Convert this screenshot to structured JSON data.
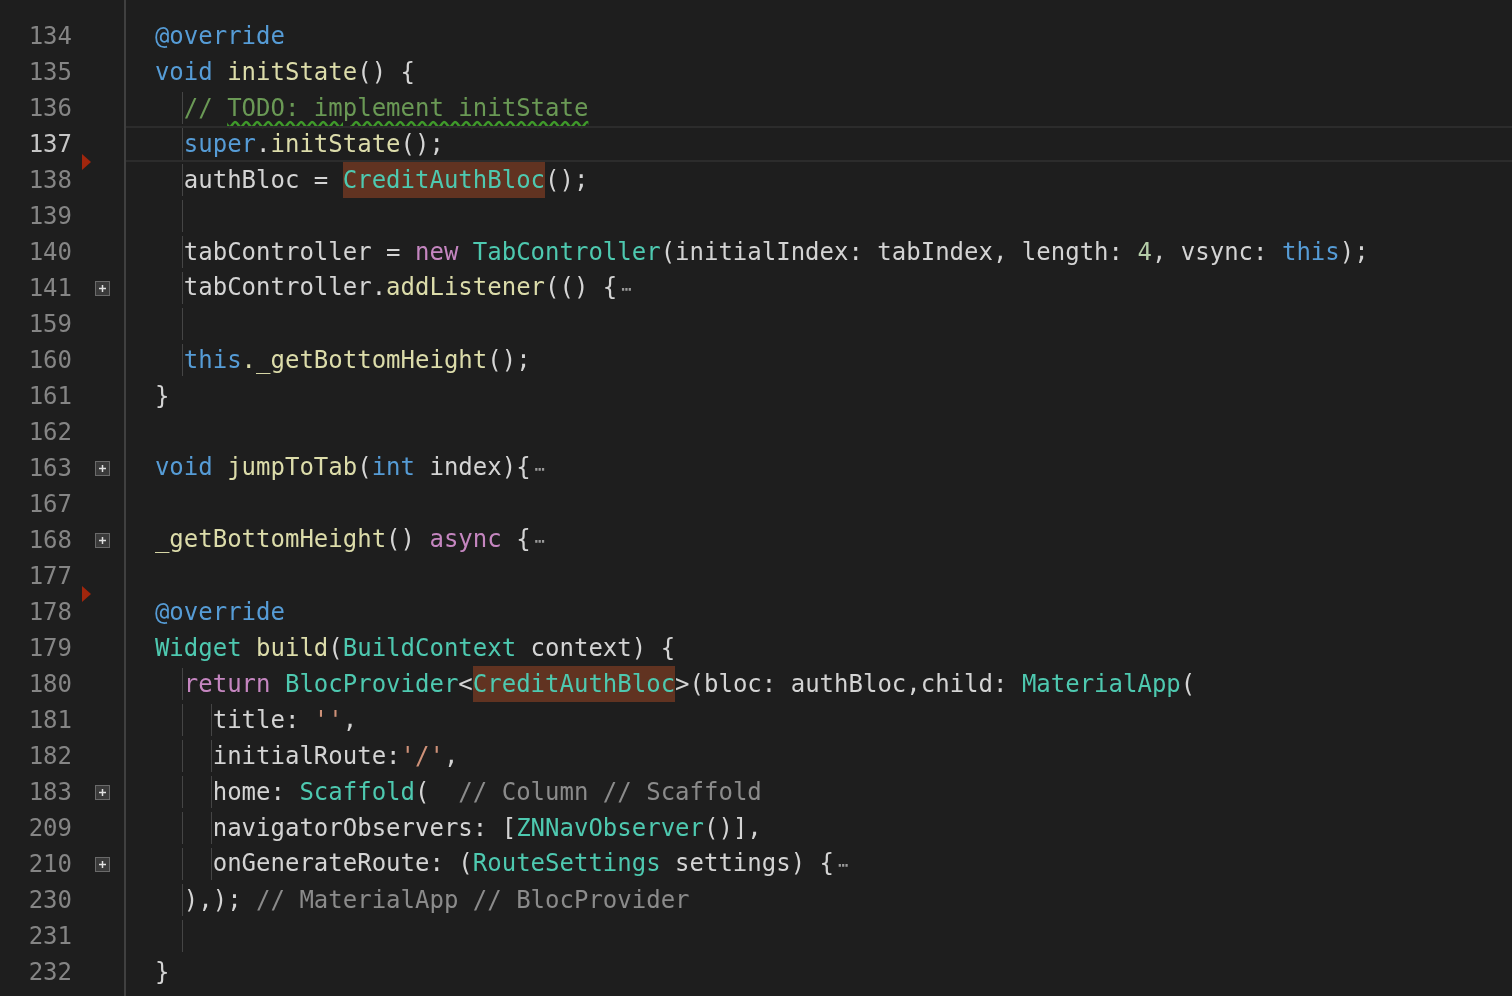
{
  "editor": {
    "lines": [
      {
        "number": "134",
        "current": false,
        "fold": false,
        "marker": false,
        "tokens": [
          {
            "kind": "keyword",
            "text": "  @override"
          }
        ]
      },
      {
        "number": "135",
        "current": false,
        "fold": false,
        "marker": false,
        "tokens": [
          {
            "kind": "keyword",
            "text": "  void "
          },
          {
            "kind": "function",
            "text": "initState"
          },
          {
            "kind": "plain",
            "text": "() {"
          }
        ]
      },
      {
        "number": "136",
        "current": false,
        "fold": false,
        "marker": false,
        "tokens": [
          {
            "kind": "comment",
            "text": "    // "
          },
          {
            "kind": "todo",
            "text": "TODO: implement initState"
          }
        ]
      },
      {
        "number": "137",
        "current": true,
        "fold": false,
        "marker": false,
        "tokens": [
          {
            "kind": "keyword",
            "text": "    super"
          },
          {
            "kind": "plain",
            "text": "."
          },
          {
            "kind": "function",
            "text": "initState"
          },
          {
            "kind": "plain",
            "text": "();"
          }
        ]
      },
      {
        "number": "138",
        "current": false,
        "fold": false,
        "marker": true,
        "tokens": [
          {
            "kind": "plain",
            "text": "    authBloc = "
          },
          {
            "kind": "match",
            "text": "CreditAuthBloc"
          },
          {
            "kind": "plain",
            "text": "();"
          }
        ]
      },
      {
        "number": "139",
        "current": false,
        "fold": false,
        "marker": false
      },
      {
        "number": "140",
        "current": false,
        "fold": false,
        "marker": false,
        "tokens": [
          {
            "kind": "plain",
            "text": "    tabController = "
          },
          {
            "kind": "control",
            "text": "new "
          },
          {
            "kind": "type",
            "text": "TabController"
          },
          {
            "kind": "plain",
            "text": "(initialIndex: tabIndex, length: "
          },
          {
            "kind": "number",
            "text": "4"
          },
          {
            "kind": "plain",
            "text": ", vsync: "
          },
          {
            "kind": "keyword",
            "text": "this"
          },
          {
            "kind": "plain",
            "text": ");"
          }
        ]
      },
      {
        "number": "141",
        "current": false,
        "fold": true,
        "marker": false,
        "tokens": [
          {
            "kind": "plain",
            "text": "    tabController."
          },
          {
            "kind": "function",
            "text": "addListener"
          },
          {
            "kind": "plain",
            "text": "(() {"
          },
          {
            "kind": "ellipsis",
            "text": "⋯"
          }
        ]
      },
      {
        "number": "159",
        "current": false,
        "fold": false,
        "marker": false
      },
      {
        "number": "160",
        "current": false,
        "fold": false,
        "marker": false,
        "tokens": [
          {
            "kind": "keyword",
            "text": "    this"
          },
          {
            "kind": "function",
            "text": "._getBottomHeight"
          },
          {
            "kind": "plain",
            "text": "();"
          }
        ]
      },
      {
        "number": "161",
        "current": false,
        "fold": false,
        "marker": false,
        "tokens": [
          {
            "kind": "plain",
            "text": "  }"
          }
        ]
      },
      {
        "number": "162",
        "current": false,
        "fold": false,
        "marker": false
      },
      {
        "number": "163",
        "current": false,
        "fold": true,
        "marker": false,
        "tokens": [
          {
            "kind": "keyword",
            "text": "  void "
          },
          {
            "kind": "function",
            "text": "jumpToTab"
          },
          {
            "kind": "plain",
            "text": "("
          },
          {
            "kind": "keyword",
            "text": "int"
          },
          {
            "kind": "plain",
            "text": " index){"
          },
          {
            "kind": "ellipsis",
            "text": "⋯"
          }
        ]
      },
      {
        "number": "167",
        "current": false,
        "fold": false,
        "marker": false
      },
      {
        "number": "168",
        "current": false,
        "fold": true,
        "marker": false,
        "tokens": [
          {
            "kind": "function",
            "text": "  _getBottomHeight"
          },
          {
            "kind": "plain",
            "text": "() "
          },
          {
            "kind": "control",
            "text": "async"
          },
          {
            "kind": "plain",
            "text": " {"
          },
          {
            "kind": "ellipsis",
            "text": "⋯"
          }
        ]
      },
      {
        "number": "177",
        "current": false,
        "fold": false,
        "marker": false
      },
      {
        "number": "178",
        "current": false,
        "fold": false,
        "marker": true,
        "tokens": [
          {
            "kind": "keyword",
            "text": "  @override"
          }
        ]
      },
      {
        "number": "179",
        "current": false,
        "fold": false,
        "marker": false,
        "tokens": [
          {
            "kind": "type",
            "text": "  Widget "
          },
          {
            "kind": "function",
            "text": "build"
          },
          {
            "kind": "plain",
            "text": "("
          },
          {
            "kind": "type",
            "text": "BuildContext"
          },
          {
            "kind": "plain",
            "text": " context) {"
          }
        ]
      },
      {
        "number": "180",
        "current": false,
        "fold": false,
        "marker": false,
        "tokens": [
          {
            "kind": "control",
            "text": "    return "
          },
          {
            "kind": "type",
            "text": "BlocProvider"
          },
          {
            "kind": "plain",
            "text": "<"
          },
          {
            "kind": "match",
            "text": "CreditAuthBloc"
          },
          {
            "kind": "plain",
            "text": ">(bloc: authBloc,child: "
          },
          {
            "kind": "type",
            "text": "MaterialApp"
          },
          {
            "kind": "plain",
            "text": "("
          }
        ]
      },
      {
        "number": "181",
        "current": false,
        "fold": false,
        "marker": false,
        "tokens": [
          {
            "kind": "plain",
            "text": "      title: "
          },
          {
            "kind": "string",
            "text": "''"
          },
          {
            "kind": "plain",
            "text": ","
          }
        ]
      },
      {
        "number": "182",
        "current": false,
        "fold": false,
        "marker": false,
        "tokens": [
          {
            "kind": "plain",
            "text": "      initialRoute:"
          },
          {
            "kind": "string",
            "text": "'/'"
          },
          {
            "kind": "plain",
            "text": ","
          }
        ]
      },
      {
        "number": "183",
        "current": false,
        "fold": true,
        "marker": false,
        "tokens": [
          {
            "kind": "plain",
            "text": "      home: "
          },
          {
            "kind": "type",
            "text": "Scaffold"
          },
          {
            "kind": "plain",
            "text": "( "
          },
          {
            "kind": "hint",
            "text": " // Column // Scaffold"
          }
        ]
      },
      {
        "number": "209",
        "current": false,
        "fold": false,
        "marker": false,
        "tokens": [
          {
            "kind": "plain",
            "text": "      navigatorObservers: ["
          },
          {
            "kind": "type",
            "text": "ZNNavObserver"
          },
          {
            "kind": "plain",
            "text": "()],"
          }
        ]
      },
      {
        "number": "210",
        "current": false,
        "fold": true,
        "marker": false,
        "tokens": [
          {
            "kind": "plain",
            "text": "      onGenerateRoute: ("
          },
          {
            "kind": "type",
            "text": "RouteSettings"
          },
          {
            "kind": "plain",
            "text": " settings) {"
          },
          {
            "kind": "ellipsis",
            "text": "⋯"
          }
        ]
      },
      {
        "number": "230",
        "current": false,
        "fold": false,
        "marker": false,
        "tokens": [
          {
            "kind": "plain",
            "text": "    ),); "
          },
          {
            "kind": "hint",
            "text": "// MaterialApp // BlocProvider"
          }
        ]
      },
      {
        "number": "231",
        "current": false,
        "fold": false,
        "marker": false
      },
      {
        "number": "232",
        "current": false,
        "fold": false,
        "marker": false,
        "tokens": [
          {
            "kind": "plain",
            "text": "  }"
          }
        ]
      }
    ]
  }
}
